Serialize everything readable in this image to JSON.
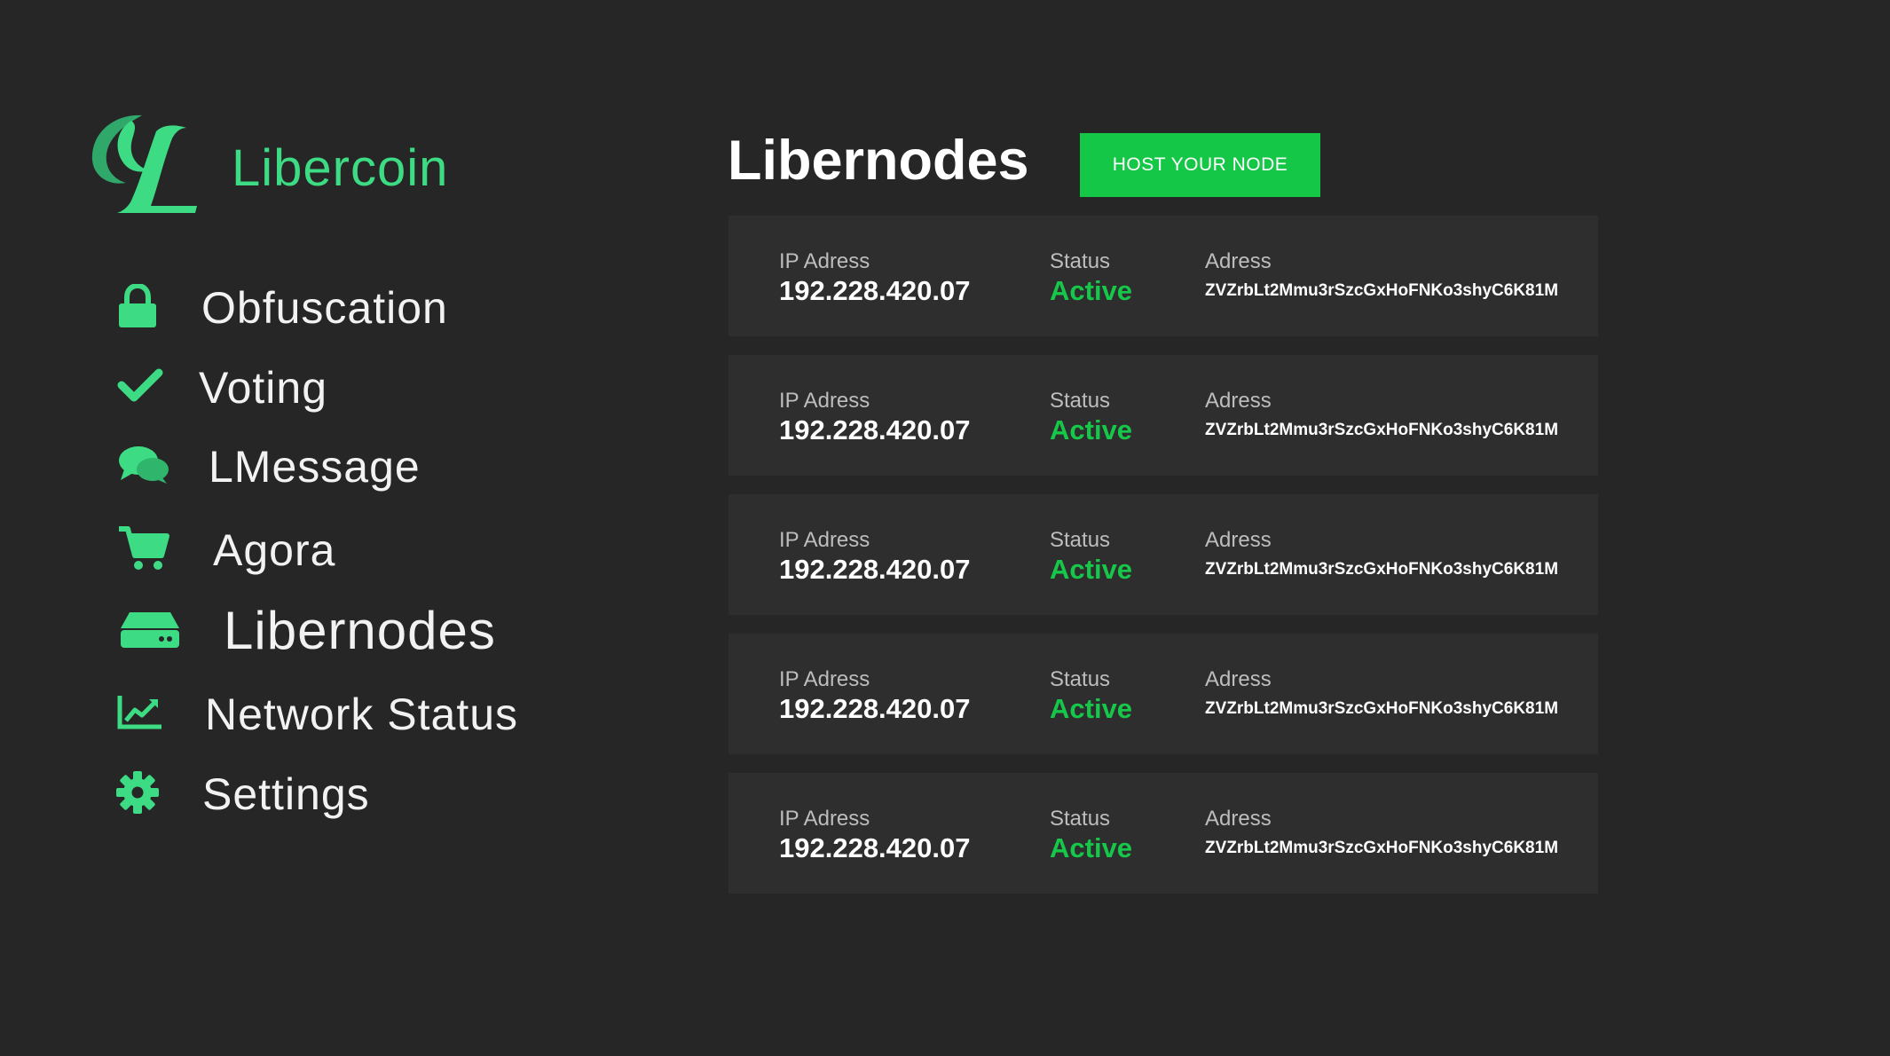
{
  "brand": {
    "name": "Libercoin",
    "accent_color": "#3ddc84"
  },
  "sidebar": {
    "items": [
      {
        "label": "Obfuscation",
        "icon": "lock-icon"
      },
      {
        "label": "Voting",
        "icon": "check-icon"
      },
      {
        "label": "LMessage",
        "icon": "chat-icon"
      },
      {
        "label": "Agora",
        "icon": "cart-icon"
      },
      {
        "label": "Libernodes",
        "icon": "hard-drive-icon",
        "active": true
      },
      {
        "label": "Network Status",
        "icon": "line-chart-icon"
      },
      {
        "label": "Settings",
        "icon": "gear-icon"
      }
    ]
  },
  "main": {
    "title": "Libernodes",
    "host_button_label": "HOST YOUR NODE",
    "host_button_color": "#15c746",
    "nodes": [
      {
        "ip_label": "IP Adress",
        "ip": "192.228.420.07",
        "status_label": "Status",
        "status": "Active",
        "address_label": "Adress",
        "address": "ZVZrbLt2Mmu3rSzcGxHoFNKo3shyC6K81M"
      },
      {
        "ip_label": "IP Adress",
        "ip": "192.228.420.07",
        "status_label": "Status",
        "status": "Active",
        "address_label": "Adress",
        "address": "ZVZrbLt2Mmu3rSzcGxHoFNKo3shyC6K81M"
      },
      {
        "ip_label": "IP Adress",
        "ip": "192.228.420.07",
        "status_label": "Status",
        "status": "Active",
        "address_label": "Adress",
        "address": "ZVZrbLt2Mmu3rSzcGxHoFNKo3shyC6K81M"
      },
      {
        "ip_label": "IP Adress",
        "ip": "192.228.420.07",
        "status_label": "Status",
        "status": "Active",
        "address_label": "Adress",
        "address": "ZVZrbLt2Mmu3rSzcGxHoFNKo3shyC6K81M"
      },
      {
        "ip_label": "IP Adress",
        "ip": "192.228.420.07",
        "status_label": "Status",
        "status": "Active",
        "address_label": "Adress",
        "address": "ZVZrbLt2Mmu3rSzcGxHoFNKo3shyC6K81M"
      }
    ],
    "status_color": "#16c84a"
  }
}
